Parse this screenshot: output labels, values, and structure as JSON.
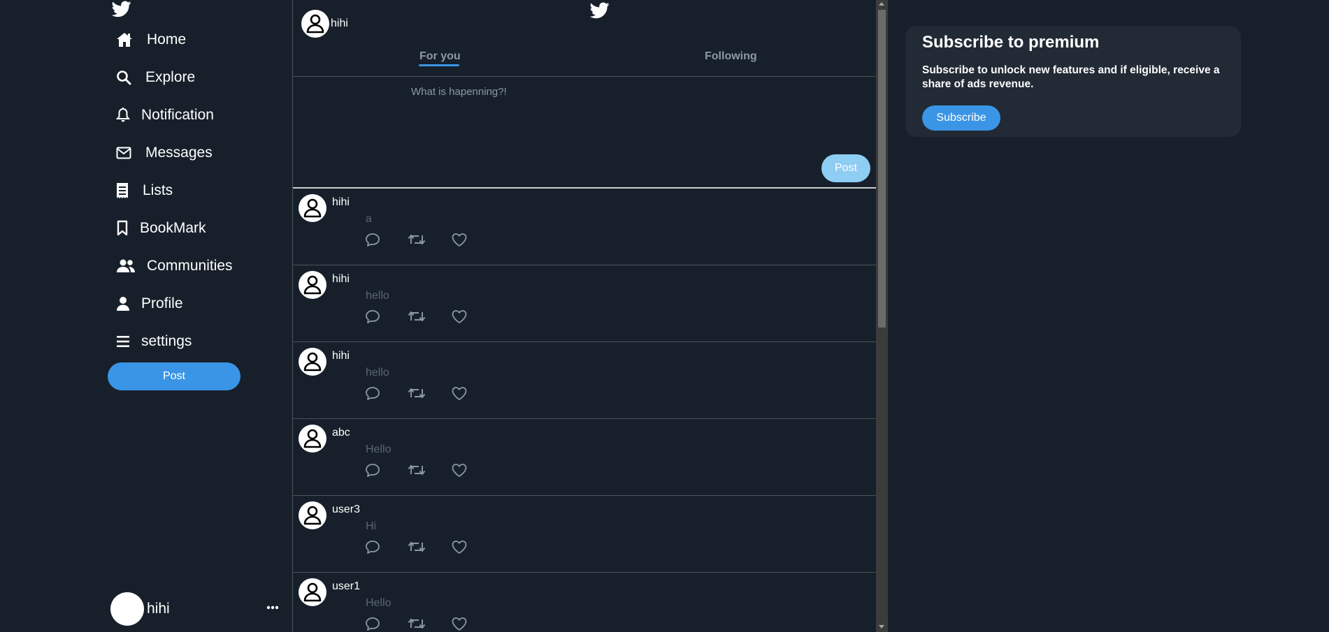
{
  "sidebar": {
    "logo_icon": "twitter-bird-icon",
    "items": [
      {
        "label": "Home",
        "icon": "home-icon"
      },
      {
        "label": "Explore",
        "icon": "search-icon"
      },
      {
        "label": "Notification",
        "icon": "bell-icon"
      },
      {
        "label": "Messages",
        "icon": "envelope-icon"
      },
      {
        "label": "Lists",
        "icon": "list-icon"
      },
      {
        "label": "BookMark",
        "icon": "bookmark-icon"
      },
      {
        "label": "Communities",
        "icon": "users-icon"
      },
      {
        "label": "Profile",
        "icon": "user-icon"
      },
      {
        "label": "settings",
        "icon": "menu-icon"
      }
    ],
    "post_label": "Post",
    "account": {
      "name": "hihi",
      "more_icon": "more-dots-icon"
    }
  },
  "header": {
    "username": "hihi",
    "tabs": [
      {
        "label": "For you",
        "active": true
      },
      {
        "label": "Following",
        "active": false
      }
    ]
  },
  "compose": {
    "placeholder": "What is hapenning?!",
    "value": "",
    "post_label": "Post"
  },
  "feed": {
    "posts": [
      {
        "user": "hihi",
        "text": "a"
      },
      {
        "user": "hihi",
        "text": "hello"
      },
      {
        "user": "hihi",
        "text": "hello"
      },
      {
        "user": "abc",
        "text": "Hello"
      },
      {
        "user": "user3",
        "text": "Hi"
      },
      {
        "user": "user1",
        "text": "Hello"
      }
    ],
    "action_icons": [
      "comment-icon",
      "retweet-icon",
      "heart-icon"
    ]
  },
  "premium": {
    "title": "Subscribe to premium",
    "description": "Subscribe to unlock new features and if eligible, receive a share of ads revenue.",
    "button_label": "Subscribe"
  },
  "colors": {
    "background": "#17202a",
    "accent": "#3b95e6",
    "compose_post_disabled": "#8ecdf4",
    "card": "#222a35"
  }
}
